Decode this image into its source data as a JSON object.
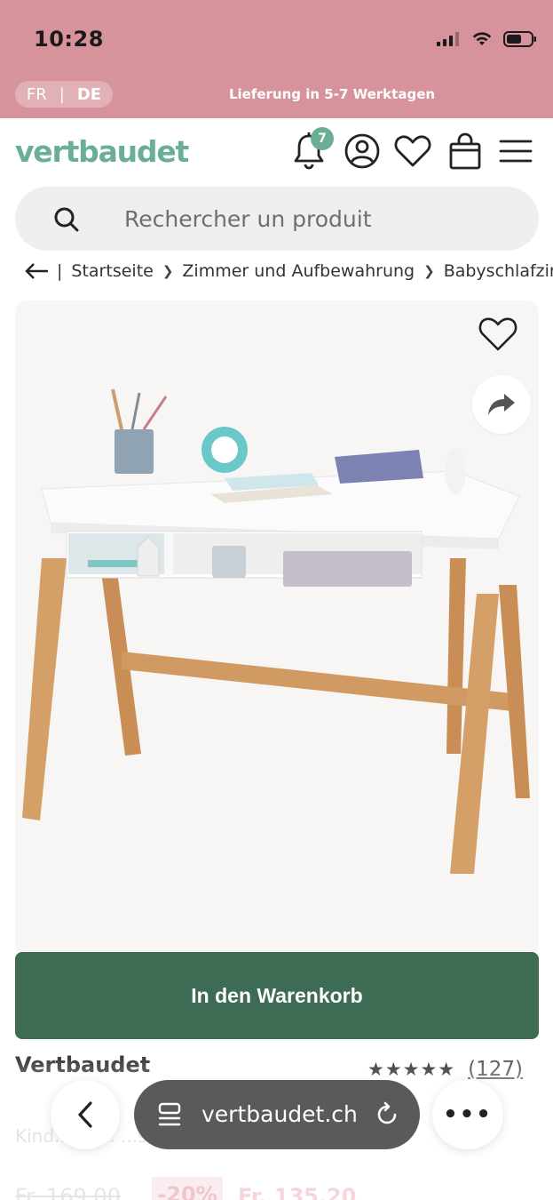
{
  "status_bar": {
    "time": "10:28"
  },
  "top_bar": {
    "lang_fr": "FR",
    "lang_separator": "|",
    "lang_de": "DE",
    "delivery_text": "Lieferung in 5-7 Werktagen"
  },
  "header": {
    "logo": "vertbaudet",
    "notification_count": "7"
  },
  "search": {
    "placeholder": "Rechercher un produit"
  },
  "breadcrumb": {
    "items": [
      "Startseite",
      "Zimmer und Aufbewahrung",
      "Babyschlafzimmer"
    ]
  },
  "product": {
    "add_to_cart_label": "In den Warenkorb",
    "brand": "Vertbaudet",
    "stars": "★★★★★",
    "review_count": "(127)",
    "description_partial": "Kind...eib... ...ss/...",
    "old_price": "Fr. 169.00",
    "discount": "-20%",
    "new_price": "Fr. 135.20"
  },
  "browser": {
    "url": "vertbaudet.ch",
    "more_label": "•••"
  },
  "colors": {
    "top_bar": "#d6939c",
    "brand_green": "#6aae94",
    "cart_button": "#3d6b54"
  }
}
